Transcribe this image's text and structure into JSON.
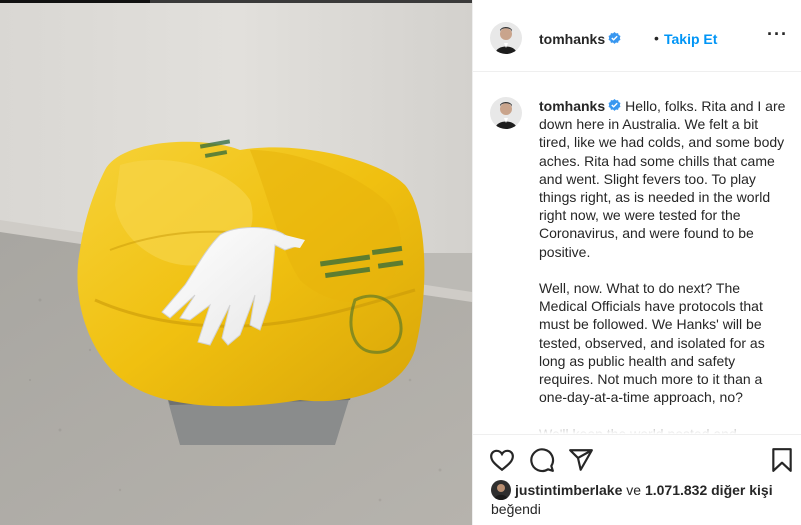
{
  "post": {
    "photo_description_icon": "trash-bin-with-glove",
    "header": {
      "username": "tomhanks",
      "verified_icon": "verified-badge-icon",
      "separator": "•",
      "follow_label": "Takip Et",
      "more_icon": "more-options-icon",
      "more_label": "···"
    },
    "caption": {
      "username": "tomhanks",
      "text": "Hello, folks. Rita and I are down here in Australia. We felt a bit tired, like we had colds, and some body aches. Rita had some chills that came and went. Slight fevers too. To play things right, as is needed in the world right now, we were tested for the Coronavirus, and were found to be positive.\n\nWell, now. What to do next? The Medical Officials have protocols that must be followed. We Hanks' will be tested, observed, and isolated for as long as public health and safety requires. Not much more to it than a one-day-at-a-time approach, no?\n\nWe'll keep the world posted and"
    },
    "actions": {
      "like_icon": "heart-icon",
      "comment_icon": "comment-icon",
      "share_icon": "paper-plane-icon",
      "save_icon": "bookmark-icon"
    },
    "likes": {
      "user": "justintimberlake",
      "connector": " ve ",
      "others": "1.071.832 diğer kişi",
      "suffix": "beğendi"
    },
    "colors": {
      "link_blue": "#0095f6",
      "verified_blue": "#3897f0",
      "bag_yellow": "#f2c318",
      "text": "#262626"
    }
  }
}
